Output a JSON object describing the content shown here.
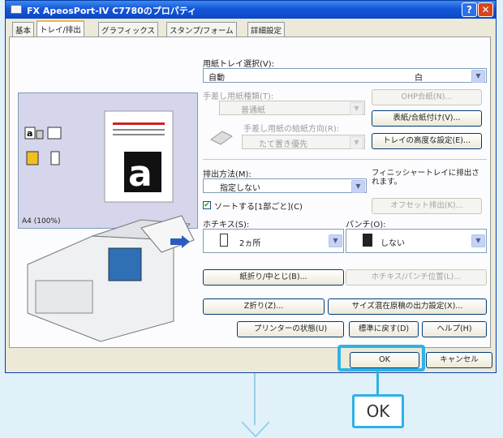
{
  "window": {
    "title": "FX ApeosPort-IV C7780のプロパティ",
    "help_glyph": "?",
    "close_glyph": "✕"
  },
  "tabs": [
    "基本",
    "トレイ/排出",
    "グラフィックス",
    "スタンプ/フォーム",
    "詳細設定"
  ],
  "preview": {
    "caption": "A4 (100%)",
    "big_letter": "a"
  },
  "paper_tray": {
    "label": "用紙トレイ選択(V):",
    "value": "自動",
    "color_value": "白"
  },
  "manual_type": {
    "label": "手差し用紙種類(T):",
    "value": "普通紙"
  },
  "manual_direction": {
    "label": "手差し用紙の給紙方向(R):",
    "value": "たて置き優先"
  },
  "right_buttons": {
    "ohp": "OHP合紙(N)...",
    "cover": "表紙/合紙付け(V)...",
    "tray_height": "トレイの高度な設定(E)..."
  },
  "output": {
    "label": "排出方法(M):",
    "value": "指定しない",
    "info": "フィニッシャートレイに排出されます。"
  },
  "sort": {
    "label": "ソートする[1部ごと](C)",
    "checked": true,
    "offset_button": "オフセット排出(K)..."
  },
  "staple": {
    "label": "ホチキス(S):",
    "value": "2ヵ所"
  },
  "punch": {
    "label": "パンチ(O):",
    "value": "しない"
  },
  "fold_buttons": {
    "fold": "紙折り/中とじ(B)...",
    "staple_pos": "ホチキス/パンチ位置(L)...",
    "z_fold": "Z折り(Z)...",
    "mixed": "サイズ混在原稿の出力設定(X)..."
  },
  "bottom_buttons": {
    "status": "プリンターの状態(U)",
    "default": "標準に戻す(D)",
    "help": "ヘルプ(H)"
  },
  "dialog_buttons": {
    "ok": "OK",
    "cancel": "キャンセル"
  },
  "callout": {
    "text": "OK"
  },
  "colors": {
    "highlight": "#2fb2e5",
    "titlebar": "#1456d8",
    "dialog_bg": "#ece9d8"
  }
}
